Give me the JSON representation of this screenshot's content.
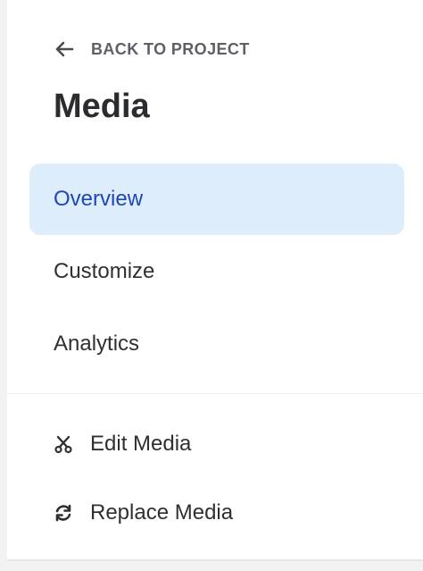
{
  "header": {
    "back_label": "BACK TO PROJECT",
    "back_icon": "arrow-left-icon",
    "title": "Media"
  },
  "nav": {
    "items": [
      {
        "label": "Overview",
        "active": true
      },
      {
        "label": "Customize",
        "active": false
      },
      {
        "label": "Analytics",
        "active": false
      }
    ]
  },
  "actions": {
    "edit": {
      "label": "Edit Media",
      "icon": "scissors-icon"
    },
    "replace": {
      "label": "Replace Media",
      "icon": "refresh-icon"
    }
  },
  "colors": {
    "active_bg": "#deedfb",
    "active_text": "#1f47b8",
    "text": "#2f3034",
    "muted": "#5f6066"
  }
}
